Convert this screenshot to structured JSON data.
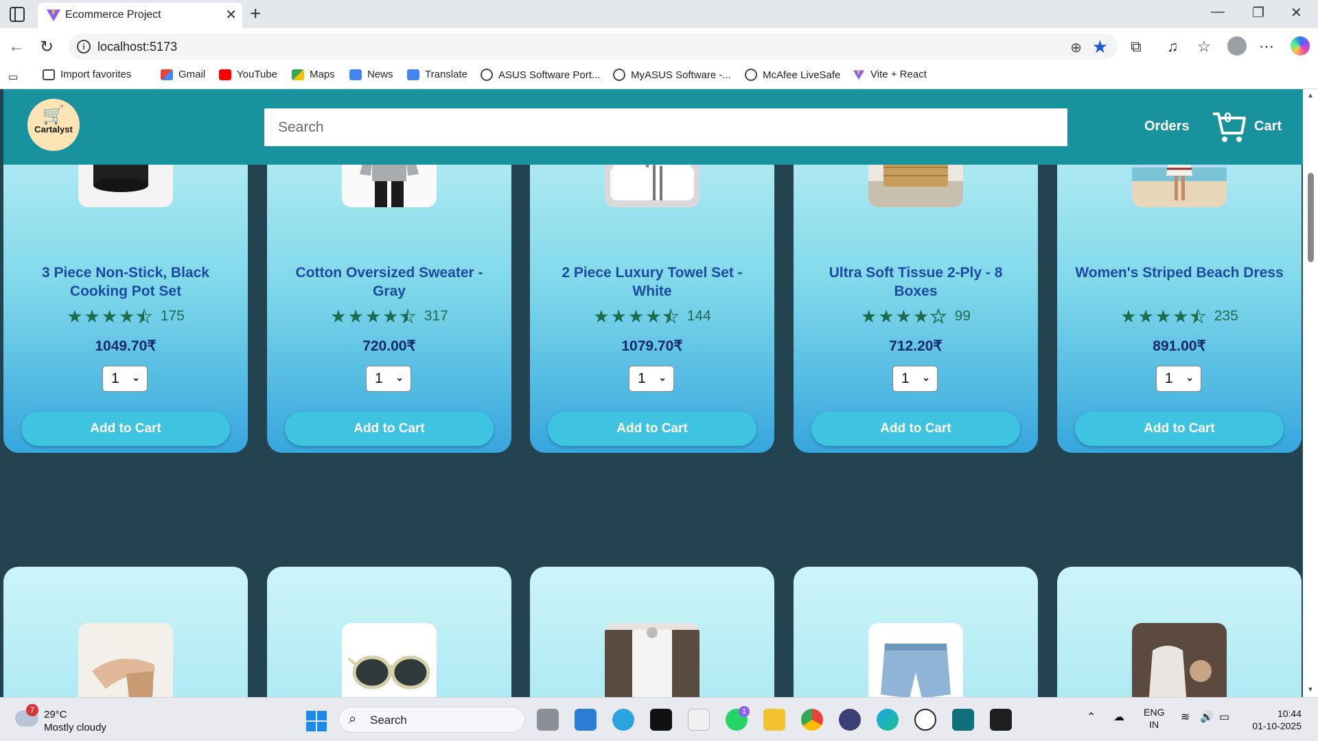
{
  "browser": {
    "tab_title": "Ecommerce Project",
    "url": "localhost:5173",
    "bookmarks": [
      {
        "label": "Import favorites",
        "icon": "import-icon"
      },
      {
        "label": "Gmail",
        "icon": "gmail-icon"
      },
      {
        "label": "YouTube",
        "icon": "youtube-icon"
      },
      {
        "label": "Maps",
        "icon": "maps-icon"
      },
      {
        "label": "News",
        "icon": "news-icon"
      },
      {
        "label": "Translate",
        "icon": "translate-icon"
      },
      {
        "label": "ASUS Software Port...",
        "icon": "globe-icon"
      },
      {
        "label": "MyASUS Software -...",
        "icon": "globe-icon"
      },
      {
        "label": "McAfee LiveSafe",
        "icon": "globe-icon"
      },
      {
        "label": "Vite + React",
        "icon": "vite-icon"
      }
    ]
  },
  "header": {
    "logo_text": "Cartalyst",
    "search_placeholder": "Search",
    "orders_label": "Orders",
    "cart_count": "0",
    "cart_label": "Cart"
  },
  "products": [
    {
      "name": "3 Piece Non-Stick, Black Cooking Pot Set",
      "rating": 4.5,
      "rating_count": "175",
      "price": "1049.70₹",
      "quantity": "1",
      "button": "Add to Cart",
      "image": "cooking-pot-image"
    },
    {
      "name": "Cotton Oversized Sweater - Gray",
      "rating": 4.5,
      "rating_count": "317",
      "price": "720.00₹",
      "quantity": "1",
      "button": "Add to Cart",
      "image": "sweater-image"
    },
    {
      "name": "2 Piece Luxury Towel Set - White",
      "rating": 4.5,
      "rating_count": "144",
      "price": "1079.70₹",
      "quantity": "1",
      "button": "Add to Cart",
      "image": "towel-image"
    },
    {
      "name": "Ultra Soft Tissue 2-Ply - 8 Boxes",
      "rating": 4.0,
      "rating_count": "99",
      "price": "712.20₹",
      "quantity": "1",
      "button": "Add to Cart",
      "image": "tissue-box-image"
    },
    {
      "name": "Women's Striped Beach Dress",
      "rating": 4.5,
      "rating_count": "235",
      "price": "891.00₹",
      "quantity": "1",
      "button": "Add to Cart",
      "image": "beach-dress-image"
    }
  ],
  "next_row_images": [
    "sandal-image",
    "sunglasses-image",
    "curtains-image",
    "denim-shorts-image",
    "humidifier-image"
  ],
  "taskbar": {
    "weather_temp": "29°C",
    "weather_desc": "Mostly cloudy",
    "weather_badge": "7",
    "search_label": "Search",
    "whatsapp_badge": "1",
    "lang_line1": "ENG",
    "lang_line2": "IN",
    "time": "10:44",
    "date": "01-10-2025"
  },
  "colors": {
    "header": "#18939d",
    "page_bg": "#22434f",
    "title": "#1c4aa0",
    "price": "#14286e",
    "stars": "#1e6b4e",
    "button": "#3ec3e1"
  }
}
